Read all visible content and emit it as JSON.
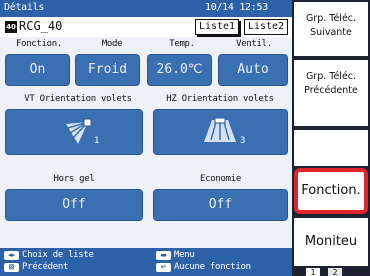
{
  "header": {
    "title": "Détails",
    "datetime": "10/14 12:53"
  },
  "unit": {
    "number": "40",
    "name": "RCG_40",
    "list1": "Liste1",
    "list2": "Liste2"
  },
  "labels": {
    "function": "Fonction.",
    "mode": "Mode",
    "temp": "Temp.",
    "fan": "Ventil.",
    "vt": "VT Orientation volets",
    "hz": "HZ Orientation volets",
    "frost": "Hors gel",
    "eco": "Economie"
  },
  "values": {
    "function": "On",
    "mode": "Froid",
    "temp": "26.0℃",
    "fan": "Auto",
    "vt_level": "1",
    "hz_level": "3",
    "frost": "Off",
    "eco": "Off"
  },
  "footer": {
    "list_choice": "Choix de liste",
    "previous": "Précédent",
    "menu": "Menu",
    "no_function": "Aucune fonction"
  },
  "side": {
    "next_group": "Grp. Téléc. Suivante",
    "prev_group": "Grp. Téléc. Précédente",
    "function_tab": "Fonction.",
    "monitor_tab": "Moniteu",
    "page1": "1",
    "page2": "2"
  },
  "colors": {
    "accent_blue": "#2c61a8",
    "button_blue": "#3a6fb2",
    "selection_red": "#e1252b"
  }
}
